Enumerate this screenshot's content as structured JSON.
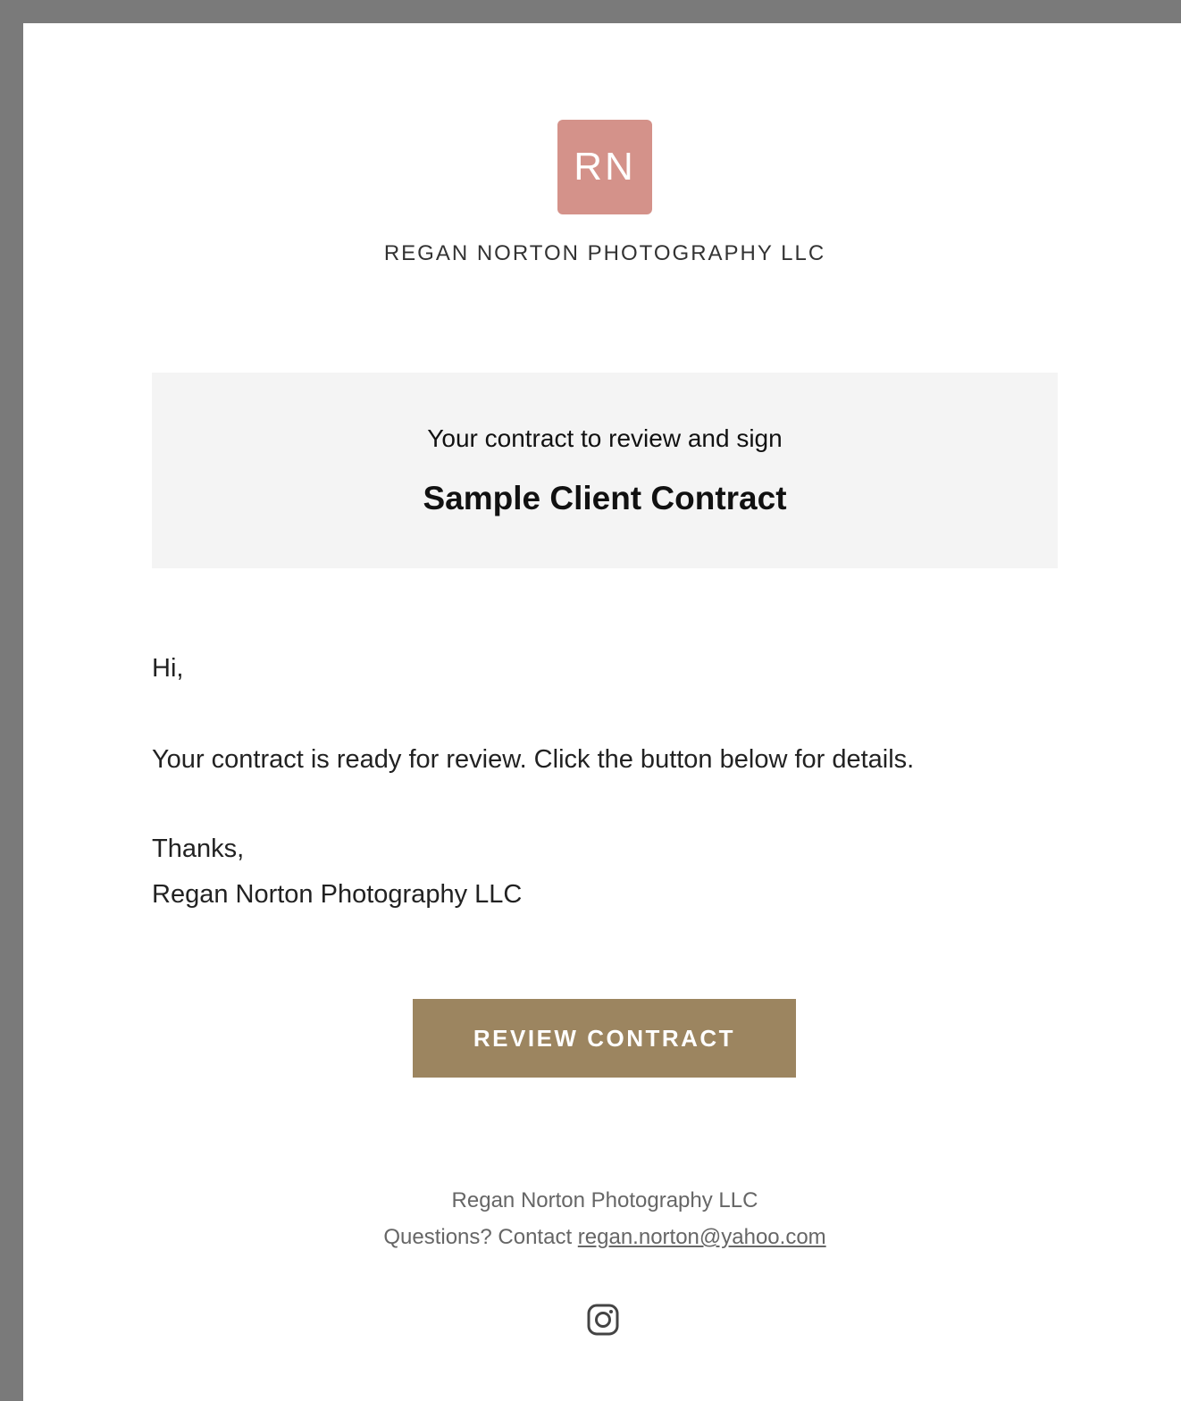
{
  "logo": {
    "initials": "RN",
    "bg_color": "#d4928a"
  },
  "brand_name": "REGAN NORTON PHOTOGRAPHY LLC",
  "banner": {
    "subtitle": "Your contract to review and sign",
    "title": "Sample Client Contract"
  },
  "body": {
    "greeting": "Hi,",
    "message": "Your contract is ready for review. Click the button below for details.",
    "thanks": "Thanks,",
    "signature": "Regan Norton Photography LLC"
  },
  "cta": {
    "label": "REVIEW CONTRACT",
    "color": "#9c8560"
  },
  "footer": {
    "company": "Regan Norton Photography LLC",
    "contact_prefix": "Questions? Contact",
    "email": "regan.norton@yahoo.com",
    "social_icon": "instagram-icon"
  }
}
